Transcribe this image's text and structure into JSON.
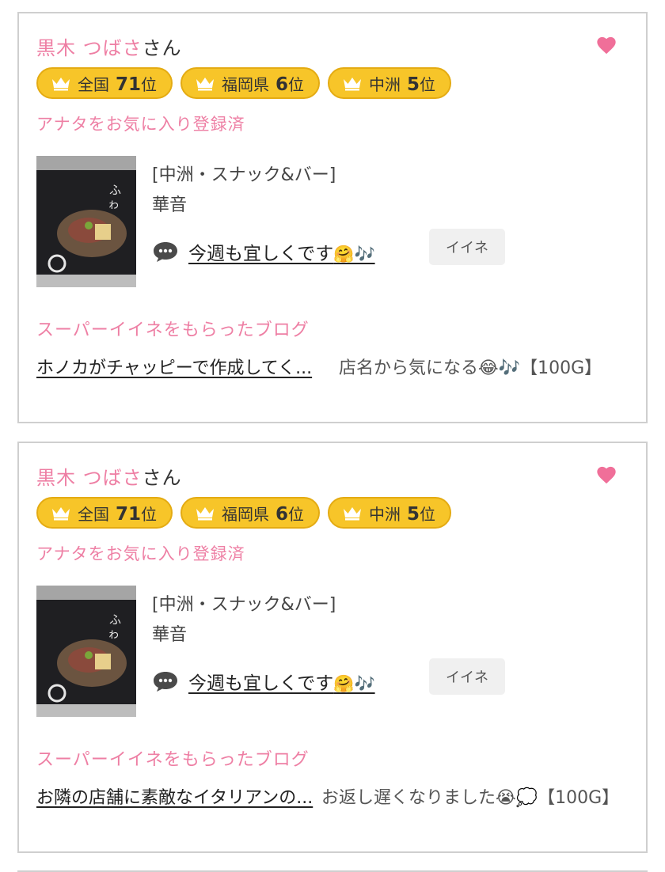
{
  "cards": [
    {
      "user_name": "黒木 つばさ",
      "name_suffix": "さん",
      "ranks": [
        {
          "label": "全国",
          "rank": "71",
          "unit": "位"
        },
        {
          "label": "福岡県",
          "rank": "6",
          "unit": "位"
        },
        {
          "label": "中洲",
          "rank": "5",
          "unit": "位"
        }
      ],
      "favorite_status": "アナタをお気に入り登録済",
      "shop_category": "[中洲・スナック&バー]",
      "shop_name": "華音",
      "comment": "今週も宜しくです",
      "comment_emoji": "🤗🎶",
      "like_label": "イイネ",
      "super_heading": "スーパーイイネをもらったブログ",
      "blog_title": "ホノカがチャッピーで作成してく...",
      "blog_comment": "店名から気になる😂🎶【100G】"
    },
    {
      "user_name": "黒木 つばさ",
      "name_suffix": "さん",
      "ranks": [
        {
          "label": "全国",
          "rank": "71",
          "unit": "位"
        },
        {
          "label": "福岡県",
          "rank": "6",
          "unit": "位"
        },
        {
          "label": "中洲",
          "rank": "5",
          "unit": "位"
        }
      ],
      "favorite_status": "アナタをお気に入り登録済",
      "shop_category": "[中洲・スナック&バー]",
      "shop_name": "華音",
      "comment": "今週も宜しくです",
      "comment_emoji": "🤗🎶",
      "like_label": "イイネ",
      "super_heading": "スーパーイイネをもらったブログ",
      "blog_title": "お隣の店舗に素敵なイタリアンの...",
      "blog_comment": "お返し遅くなりました😭💭【100G】"
    }
  ],
  "colors": {
    "accent_pink": "#ee7fa4",
    "badge_gold": "#f7c529",
    "border": "#cfcfcf"
  },
  "icons": {
    "favorite": "heart-icon",
    "rank": "crown-icon",
    "comment": "speech-bubble-icon"
  }
}
